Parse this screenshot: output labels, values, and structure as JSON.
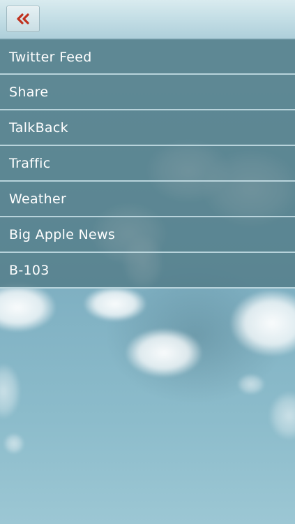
{
  "topbar": {
    "back_icon": "double-chevron-left-icon",
    "back_icon_color": "#c0311e"
  },
  "menu": {
    "items": [
      {
        "label": "Twitter Feed"
      },
      {
        "label": "Share"
      },
      {
        "label": "TalkBack"
      },
      {
        "label": "Traffic"
      },
      {
        "label": "Weather"
      },
      {
        "label": "Big Apple News"
      },
      {
        "label": "B-103"
      }
    ]
  },
  "theme": {
    "menu_background": "#4c7480",
    "menu_divider": "#c8e1e8",
    "sky": "#86b6c6"
  }
}
